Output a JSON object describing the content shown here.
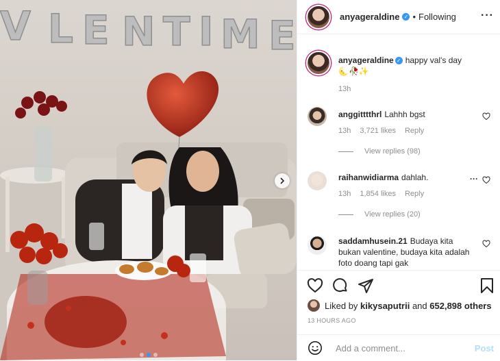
{
  "photo": {
    "balloon_text": "VALENTINE"
  },
  "post_header": {
    "username": "anyageraldine",
    "follow_status": "Following"
  },
  "caption": {
    "username": "anyageraldine",
    "text": "happy val's day",
    "emoji": "🌜🥀✨",
    "time": "13h"
  },
  "comments": [
    {
      "username": "anggitttthrl",
      "text": "Lahhh bgst",
      "time": "13h",
      "likes": "3,721 likes",
      "reply": "Reply",
      "view_replies": "View replies (98)"
    },
    {
      "username": "raihanwidiarma",
      "text": "dahlah.",
      "time": "13h",
      "likes": "1,854 likes",
      "reply": "Reply",
      "view_replies": "View replies (20)"
    },
    {
      "username": "saddamhusein.21",
      "text": "Budaya kita bukan valentine, budaya kita adalah foto doang tapi gak"
    }
  ],
  "likes_line": {
    "prefix": "Liked by",
    "user": "kikysaputrii",
    "and": "and",
    "others": "652,898 others"
  },
  "time_ago": "13 HOURS AGO",
  "add_comment": {
    "placeholder": "Add a comment...",
    "post_label": "Post"
  },
  "colors": {
    "accent": "#3897f0",
    "post_disabled": "#b2dffc",
    "muted": "#8e8e8e"
  }
}
